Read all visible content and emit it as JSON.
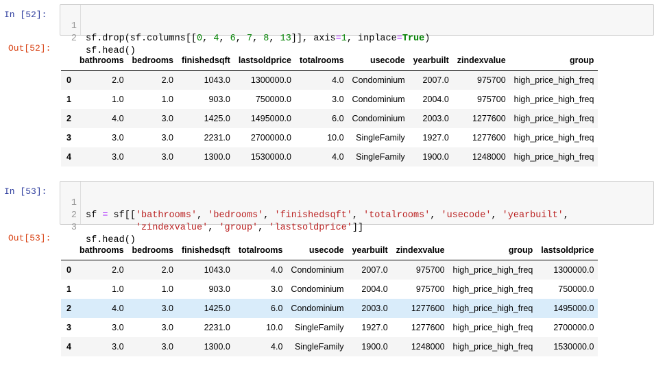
{
  "cells": [
    {
      "in_prompt": "In  [52]:",
      "out_prompt": "Out[52]:",
      "lines": [
        {
          "no": "1",
          "code": "sf.drop(sf.columns[[0, 4, 6, 7, 8, 13]], axis=1, inplace=True)"
        },
        {
          "no": "2",
          "code": "sf.head()"
        }
      ],
      "table": {
        "columns": [
          "",
          "bathrooms",
          "bedrooms",
          "finishedsqft",
          "lastsoldprice",
          "totalrooms",
          "usecode",
          "yearbuilt",
          "zindexvalue",
          "group"
        ],
        "rows": [
          [
            "0",
            "2.0",
            "2.0",
            "1043.0",
            "1300000.0",
            "4.0",
            "Condominium",
            "2007.0",
            "975700",
            "high_price_high_freq"
          ],
          [
            "1",
            "1.0",
            "1.0",
            "903.0",
            "750000.0",
            "3.0",
            "Condominium",
            "2004.0",
            "975700",
            "high_price_high_freq"
          ],
          [
            "2",
            "4.0",
            "3.0",
            "1425.0",
            "1495000.0",
            "6.0",
            "Condominium",
            "2003.0",
            "1277600",
            "high_price_high_freq"
          ],
          [
            "3",
            "3.0",
            "3.0",
            "2231.0",
            "2700000.0",
            "10.0",
            "SingleFamily",
            "1927.0",
            "1277600",
            "high_price_high_freq"
          ],
          [
            "4",
            "3.0",
            "3.0",
            "1300.0",
            "1530000.0",
            "4.0",
            "SingleFamily",
            "1900.0",
            "1248000",
            "high_price_high_freq"
          ]
        ]
      }
    },
    {
      "in_prompt": "In  [53]:",
      "out_prompt": "Out[53]:",
      "lines": [
        {
          "no": "1",
          "code": "sf = sf[['bathrooms', 'bedrooms', 'finishedsqft', 'totalrooms', 'usecode', 'yearbuilt',"
        },
        {
          "no": "2",
          "code": "         'zindexvalue', 'group', 'lastsoldprice']]"
        },
        {
          "no": "3",
          "code": "sf.head()"
        }
      ],
      "table": {
        "columns": [
          "",
          "bathrooms",
          "bedrooms",
          "finishedsqft",
          "totalrooms",
          "usecode",
          "yearbuilt",
          "zindexvalue",
          "group",
          "lastsoldprice"
        ],
        "rows": [
          [
            "0",
            "2.0",
            "2.0",
            "1043.0",
            "4.0",
            "Condominium",
            "2007.0",
            "975700",
            "high_price_high_freq",
            "1300000.0"
          ],
          [
            "1",
            "1.0",
            "1.0",
            "903.0",
            "3.0",
            "Condominium",
            "2004.0",
            "975700",
            "high_price_high_freq",
            "750000.0"
          ],
          [
            "2",
            "4.0",
            "3.0",
            "1425.0",
            "6.0",
            "Condominium",
            "2003.0",
            "1277600",
            "high_price_high_freq",
            "1495000.0"
          ],
          [
            "3",
            "3.0",
            "3.0",
            "2231.0",
            "10.0",
            "SingleFamily",
            "1927.0",
            "1277600",
            "high_price_high_freq",
            "2700000.0"
          ],
          [
            "4",
            "3.0",
            "3.0",
            "1300.0",
            "4.0",
            "SingleFamily",
            "1900.0",
            "1248000",
            "high_price_high_freq",
            "1530000.0"
          ]
        ],
        "highlighted_row": 2
      }
    }
  ]
}
